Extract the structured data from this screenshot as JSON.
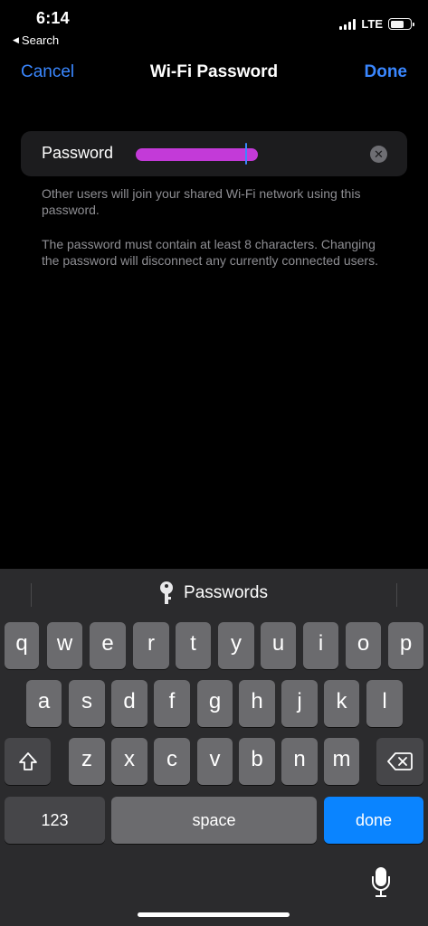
{
  "status_bar": {
    "time": "6:14",
    "back_label": "Search",
    "network": "LTE"
  },
  "nav": {
    "cancel_label": "Cancel",
    "title": "Wi-Fi Password",
    "done_label": "Done"
  },
  "password_field": {
    "label": "Password",
    "value": "",
    "redaction_color": "#c33ad8"
  },
  "notes": {
    "line1": "Other users will join your shared Wi-Fi network using this password.",
    "line2": "The password must contain at least 8 characters. Changing the password will disconnect any currently connected users."
  },
  "keyboard": {
    "suggestion": "Passwords",
    "row1": [
      "q",
      "w",
      "e",
      "r",
      "t",
      "y",
      "u",
      "i",
      "o",
      "p"
    ],
    "row2": [
      "a",
      "s",
      "d",
      "f",
      "g",
      "h",
      "j",
      "k",
      "l"
    ],
    "row3": [
      "z",
      "x",
      "c",
      "v",
      "b",
      "n",
      "m"
    ],
    "numbers_label": "123",
    "space_label": "space",
    "done_label": "done"
  },
  "colors": {
    "accent": "#3a87ff",
    "done_key": "#0a84ff"
  }
}
